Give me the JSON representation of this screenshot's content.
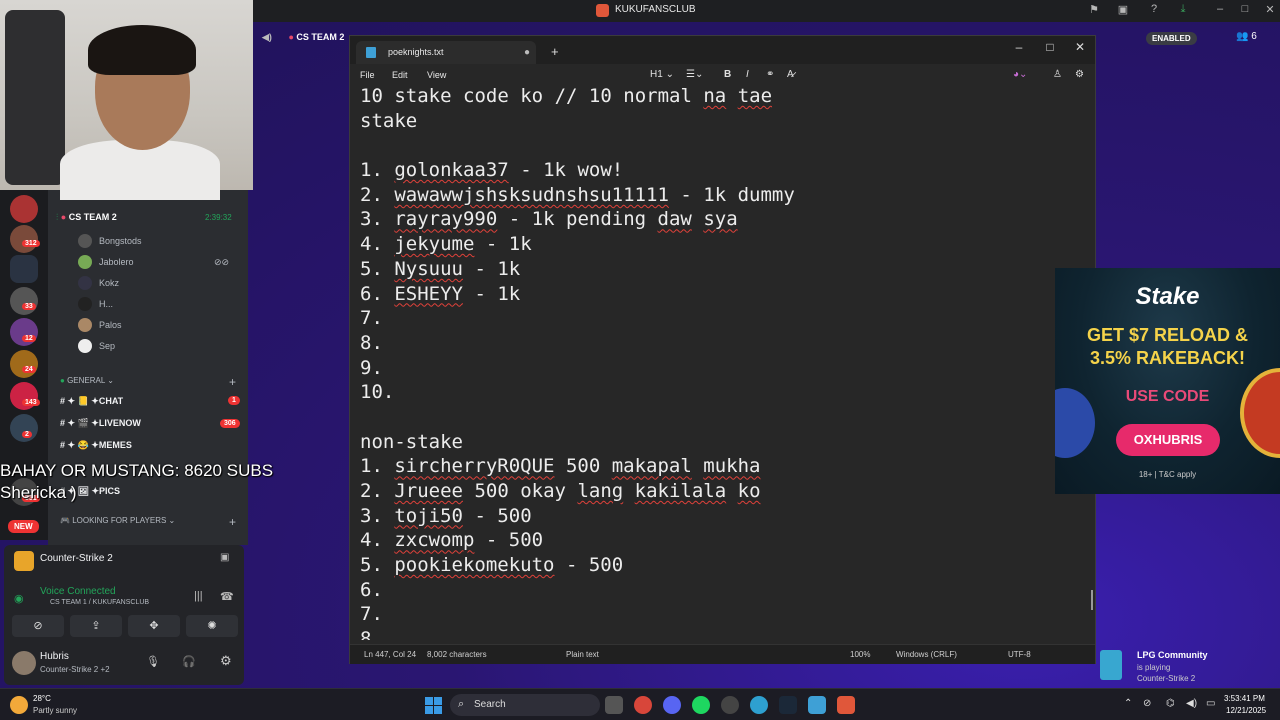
{
  "window": {
    "title": "KUKUFANSCLUB"
  },
  "server": {
    "channel_header": "CS TEAM 2",
    "enabled_label": "ENABLED",
    "member_count": "6"
  },
  "stream_overlay": {
    "line1": "BAHAY OR MUSTANG: 8620 SUBS",
    "line2": "Shericka )"
  },
  "sidebar": {
    "voice_channel": {
      "name": "CS TEAM 2",
      "timer": "2:39:32"
    },
    "voice_members": [
      "Bongstods",
      "Jabolero",
      "Kokz",
      "H...",
      "Palos",
      "Sep"
    ],
    "category_general": "GENERAL",
    "text_channels": [
      {
        "label": "✦CHAT",
        "badge": "1"
      },
      {
        "label": "✦LIVENOW",
        "badge": "306"
      },
      {
        "label": "✦MEMES",
        "badge": ""
      },
      {
        "label": "✦PICS",
        "badge": ""
      }
    ],
    "category_lfp": "LOOKING FOR PLAYERS",
    "server_badges": [
      "312",
      "33",
      "12",
      "24",
      "143",
      "2",
      "551"
    ],
    "new_label": "NEW"
  },
  "voice_panel": {
    "game": "Counter-Strike 2",
    "status": "Voice Connected",
    "location": "CS TEAM 1 / KUKUFANSCLUB",
    "user": "Hubris",
    "user_activity": "Counter-Strike 2 +2"
  },
  "notepad": {
    "tab_name": "poeknights.txt",
    "menu": [
      "File",
      "Edit",
      "View"
    ],
    "heading_tool": "H1",
    "lines": [
      "10 stake code ko // 10 normal na tae",
      "stake",
      "",
      "1. golonkaa37 - 1k wow!",
      "2. wawawwjshsksudnshsu11111 - 1k dummy",
      "3. rayray990 - 1k pending daw sya",
      "4. jekyume - 1k",
      "5. Nysuuu - 1k",
      "6. ESHEYY - 1k",
      "7.",
      "8.",
      "9.",
      "10.",
      "",
      "non-stake",
      "1. sircherryR0QUE 500 makapal mukha",
      "2. Jrueee 500 okay lang kakilala ko",
      "3. toji50 - 500",
      "4. zxcwomp - 500",
      "5. pookiekomekuto - 500",
      "6.",
      "7.",
      "8."
    ],
    "status": {
      "position": "Ln 447, Col 24",
      "chars": "8,002 characters",
      "format": "Plain text",
      "zoom": "100%",
      "line_ending": "Windows (CRLF)",
      "encoding": "UTF-8"
    }
  },
  "stake_ad": {
    "logo": "Stake",
    "headline1": "GET $7 RELOAD &",
    "headline2": "3.5% RAKEBACK!",
    "use_code": "USE CODE",
    "code": "OXHUBRIS",
    "fine_print": "18+ | T&C apply"
  },
  "activity": {
    "title": "LPG Community",
    "status": "is playing",
    "game": "Counter-Strike 2"
  },
  "taskbar": {
    "temperature": "28°C",
    "weather": "Partly sunny",
    "search_label": "Search",
    "time": "3:53:41 PM",
    "date": "12/21/2025"
  }
}
